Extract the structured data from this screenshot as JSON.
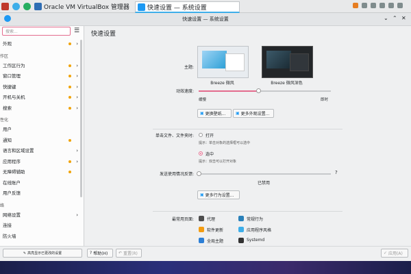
{
  "taskbar": {
    "apps": [
      {
        "label": "Oracle VM VirtualBox 管理器",
        "icon": "virtualbox-icon"
      },
      {
        "label": "快速设置 — 系统设置",
        "icon": "settings-icon"
      }
    ]
  },
  "window": {
    "title": "快速设置 — 系统设置"
  },
  "sidebar": {
    "search_placeholder": "搜索...",
    "items": [
      {
        "label": "外观",
        "type": "item"
      },
      {
        "label": "作区",
        "type": "category"
      },
      {
        "label": "工作区行为",
        "type": "item"
      },
      {
        "label": "窗口管理",
        "type": "item"
      },
      {
        "label": "快捷键",
        "type": "item"
      },
      {
        "label": "开机与关机",
        "type": "item"
      },
      {
        "label": "搜索",
        "type": "item"
      },
      {
        "label": "性化",
        "type": "category"
      },
      {
        "label": "用户",
        "type": "item"
      },
      {
        "label": "通知",
        "type": "item"
      },
      {
        "label": "语言和区域设置",
        "type": "item"
      },
      {
        "label": "应用程序",
        "type": "item"
      },
      {
        "label": "无障碍辅助",
        "type": "item"
      },
      {
        "label": "在线账户",
        "type": "item"
      },
      {
        "label": "用户反馈",
        "type": "item"
      },
      {
        "label": "络",
        "type": "category"
      },
      {
        "label": "网络设置",
        "type": "item"
      },
      {
        "label": "连接",
        "type": "item"
      },
      {
        "label": "防火墙",
        "type": "item"
      }
    ],
    "highlight_changed_label": "高亮显示已更改的设置"
  },
  "main": {
    "page_title": "快速设置",
    "theme": {
      "label": "主题:",
      "light_name": "Breeze 微风",
      "dark_name": "Breeze 微风深色"
    },
    "animation": {
      "label": "动效速度:",
      "min_label": "缓慢",
      "max_label": "即时",
      "value_fraction": 0.45
    },
    "wallpaper_button": "更换壁纸...",
    "more_appearance_button": "更多外观设置...",
    "click_behavior": {
      "label": "单击文件、文件夹时:",
      "option_open": "打开",
      "option_open_hint": "提示：单击对象的选择框可以选中",
      "option_select": "选中",
      "option_select_hint": "提示：双击可以打开对象",
      "selected": "选中"
    },
    "feedback": {
      "label": "发送使用情况反馈:",
      "value_label": "已禁用",
      "help": "?"
    },
    "more_behavior_button": "更多行为设置...",
    "frequent": {
      "label": "最常用页面:",
      "items": [
        {
          "label": "代理",
          "icon": "proxy-icon",
          "color": "#4d4d4d"
        },
        {
          "label": "常规行为",
          "icon": "general-behavior-icon",
          "color": "#2980b9"
        },
        {
          "label": "软件更新",
          "icon": "software-update-icon",
          "color": "#f39c12"
        },
        {
          "label": "应用程序风格",
          "icon": "app-style-icon",
          "color": "#3daee9"
        },
        {
          "label": "全局主题",
          "icon": "global-theme-icon",
          "color": "#2c7fd6"
        },
        {
          "label": "Systemd",
          "icon": "systemd-icon",
          "color": "#333333"
        }
      ]
    }
  },
  "bottom": {
    "help_button": "帮助(H)",
    "reset_button": "重置(R)",
    "apply_button": "应用(A)"
  },
  "colors": {
    "accent": "#3daee9",
    "highlight": "#e36b8d",
    "change_dot": "#f0a30a"
  }
}
